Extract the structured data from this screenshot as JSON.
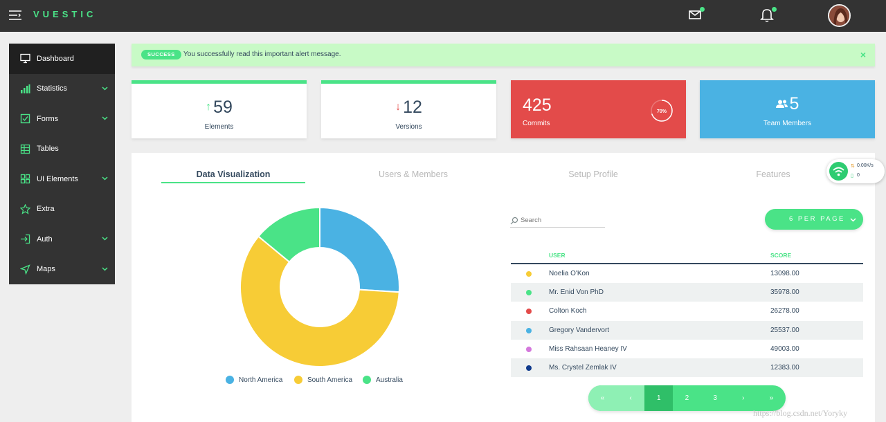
{
  "app": {
    "logo": "VUESTIC"
  },
  "sidebar": {
    "items": [
      {
        "label": "Dashboard",
        "icon": "monitor-icon"
      },
      {
        "label": "Statistics",
        "icon": "bar-chart-icon"
      },
      {
        "label": "Forms",
        "icon": "checkbox-icon"
      },
      {
        "label": "Tables",
        "icon": "table-icon"
      },
      {
        "label": "UI Elements",
        "icon": "grid-icon"
      },
      {
        "label": "Extra",
        "icon": "star-icon"
      },
      {
        "label": "Auth",
        "icon": "login-icon"
      },
      {
        "label": "Maps",
        "icon": "navigation-icon"
      }
    ]
  },
  "alert": {
    "badge": "SUCCESS",
    "message": "You successfully read this important alert message.",
    "close": "×"
  },
  "stats": [
    {
      "value": "59",
      "label": "Elements",
      "arrow": "↑"
    },
    {
      "value": "12",
      "label": "Versions",
      "arrow": "↓"
    },
    {
      "value": "425",
      "label": "Commits",
      "progress_text": "70%",
      "progress": 0.7
    },
    {
      "value": "5",
      "label": "Team Members"
    }
  ],
  "tabs": [
    "Data Visualization",
    "Users & Members",
    "Setup Profile",
    "Features"
  ],
  "donut": {
    "segments": [
      {
        "name": "North America",
        "value": 26,
        "color": "#4ab2e3"
      },
      {
        "name": "South America",
        "value": 60,
        "color": "#f7cc36"
      },
      {
        "name": "Australia",
        "value": 14,
        "color": "#4ae387"
      }
    ]
  },
  "table": {
    "search_placeholder": "Search",
    "per_page": "6 PER PAGE",
    "headers": {
      "user": "USER",
      "score": "SCORE"
    },
    "rows": [
      {
        "name": "Noelia O'Kon",
        "score": "13098.00",
        "color": "#f7cc36"
      },
      {
        "name": "Mr. Enid Von PhD",
        "score": "35978.00",
        "color": "#4ae387"
      },
      {
        "name": "Colton Koch",
        "score": "26278.00",
        "color": "#e34b4a"
      },
      {
        "name": "Gregory Vandervort",
        "score": "25537.00",
        "color": "#4ab2e3"
      },
      {
        "name": "Miss Rahsaan Heaney IV",
        "score": "49003.00",
        "color": "#d478dc"
      },
      {
        "name": "Ms. Crystel Zemlak IV",
        "score": "12383.00",
        "color": "#103a8c"
      }
    ],
    "pagination": [
      "«",
      "‹",
      "1",
      "2",
      "3",
      "›",
      "»"
    ]
  },
  "network": {
    "speed": "0.00K/s",
    "count": "0"
  },
  "watermark": "https://blog.csdn.net/Yoryky"
}
